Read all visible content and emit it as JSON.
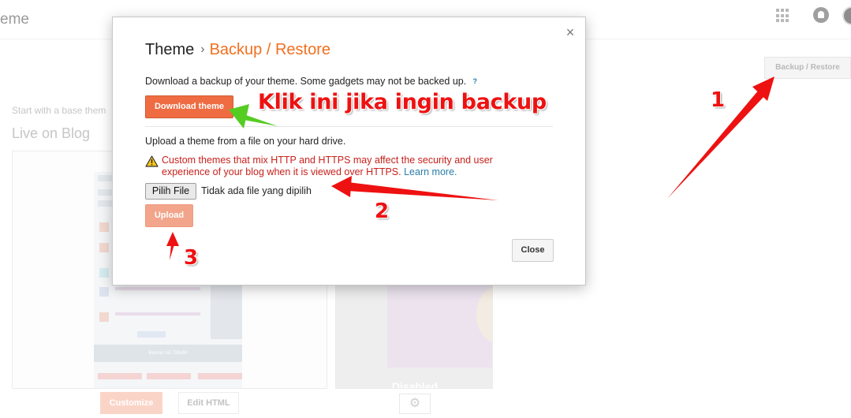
{
  "header": {
    "app_title": "eme"
  },
  "background": {
    "backup_restore_label": "Backup / Restore",
    "start_text": "Start with a base them",
    "live_title": "Live on Blog",
    "banner_text": "Banner Ad 728x90",
    "mobile_disabled_text": "Disabled",
    "customize_label": "Customize",
    "edit_html_label": "Edit HTML",
    "settings_glyph": "⚙"
  },
  "dialog": {
    "close_glyph": "×",
    "title": "Theme",
    "breadcrumb_separator": "›",
    "breadcrumb_current": "Backup / Restore",
    "download_text": "Download a backup of your theme. Some gadgets may not be backed up.",
    "help_glyph": "?",
    "download_button": "Download theme",
    "upload_text": "Upload a theme from a file on your hard drive.",
    "warning_text": "Custom themes that mix HTTP and HTTPS may affect the security and user experience of your blog when it is viewed over HTTPS.",
    "learn_more": "Learn more.",
    "file_button": "Pilih File",
    "file_status": "Tidak ada file yang dipilih",
    "upload_button": "Upload",
    "close_button": "Close"
  },
  "annotations": {
    "caption": "Klik ini jika ingin backup",
    "step1": "1",
    "step2": "2",
    "step3": "3",
    "red_color": "#ee1111",
    "green_color": "#55cc22"
  },
  "colors": {
    "accent_orange": "#f26f1e",
    "button_orange": "#ef6c43",
    "warning_red": "#c7211c",
    "link_blue": "#2a7ea8"
  },
  "icons": [
    "apps-grid-icon",
    "notifications-icon",
    "avatar",
    "help-icon",
    "warning-icon",
    "close-icon",
    "gear-icon"
  ]
}
